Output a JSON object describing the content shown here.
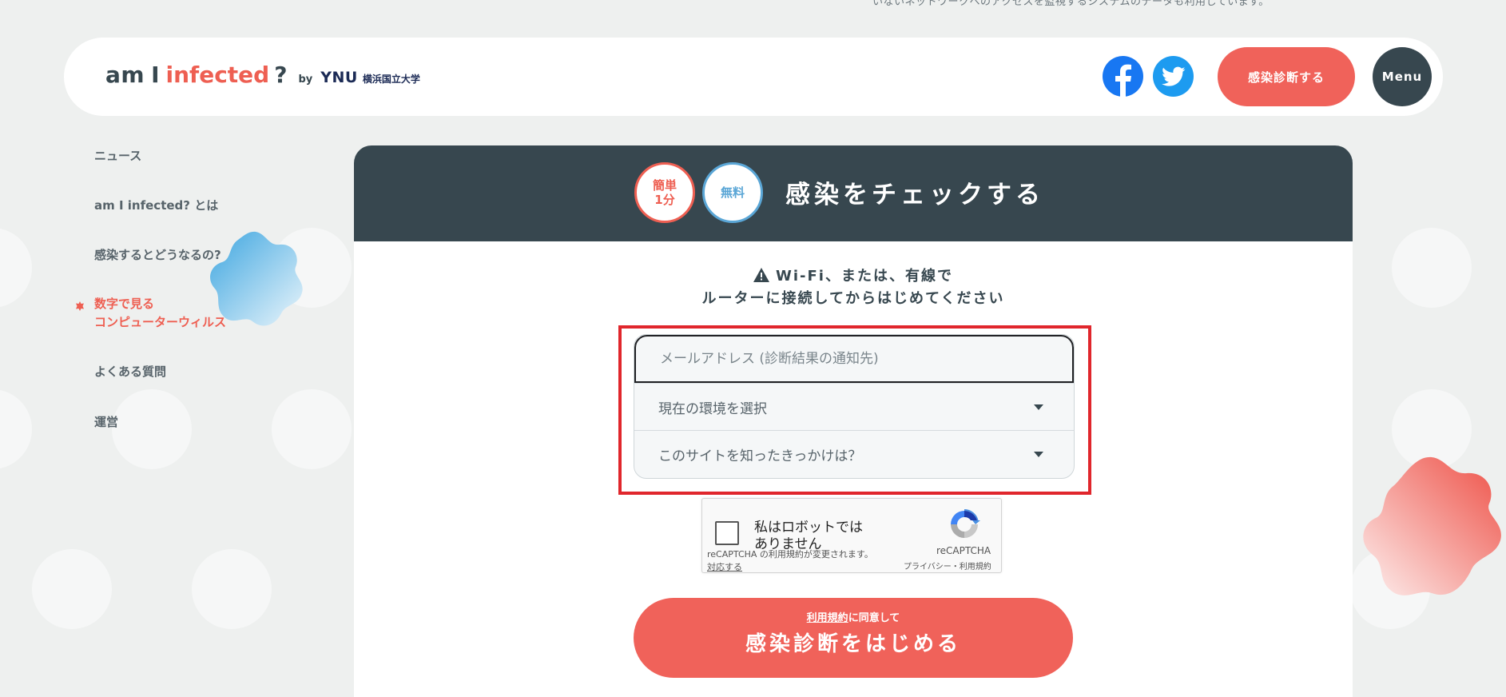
{
  "top_text": "いないネットワークへのアクセスを監視するシステムのデータも利用しています。",
  "header": {
    "logo": {
      "am": "am",
      "i": "I",
      "infected": "infected",
      "q": "?",
      "by": "by",
      "ynu": "YNU",
      "university": "横浜国立大学"
    },
    "cta_label": "感染診断する",
    "menu_label": "Menu"
  },
  "nav": {
    "items": [
      {
        "label": "ニュース"
      },
      {
        "label": "am I infected? とは"
      },
      {
        "label": "感染するとどうなるの?"
      },
      {
        "label_line1": "数字で見る",
        "label_line2": "コンピューターウィルス",
        "active": true
      },
      {
        "label": "よくある質問"
      },
      {
        "label": "運営"
      }
    ]
  },
  "card": {
    "badge_quick_line1": "簡単",
    "badge_quick_line2": "1分",
    "badge_free": "無料",
    "title": "感染をチェックする",
    "warning_line1": "Wi-Fi、または、有線で",
    "warning_line2": "ルーターに接続してからはじめてください"
  },
  "form": {
    "email_placeholder": "メールアドレス (診断結果の通知先)",
    "env_select": "現在の環境を選択",
    "how_select": "このサイトを知ったきっかけは？"
  },
  "recaptcha": {
    "label": "私はロボットではありません",
    "brand": "reCAPTCHA",
    "links": "プライバシー・利用規約",
    "notice": "reCAPTCHA の利用規約が変更されます。",
    "respond": "対応する"
  },
  "submit": {
    "terms_link": "利用規約",
    "terms_suffix": "に同意して",
    "label": "感染診断をはじめる"
  },
  "colors": {
    "accent": "#f0625a",
    "dark": "#37474f",
    "highlight": "#e0262c",
    "facebook": "#1877f2",
    "twitter": "#1d9bf0"
  }
}
